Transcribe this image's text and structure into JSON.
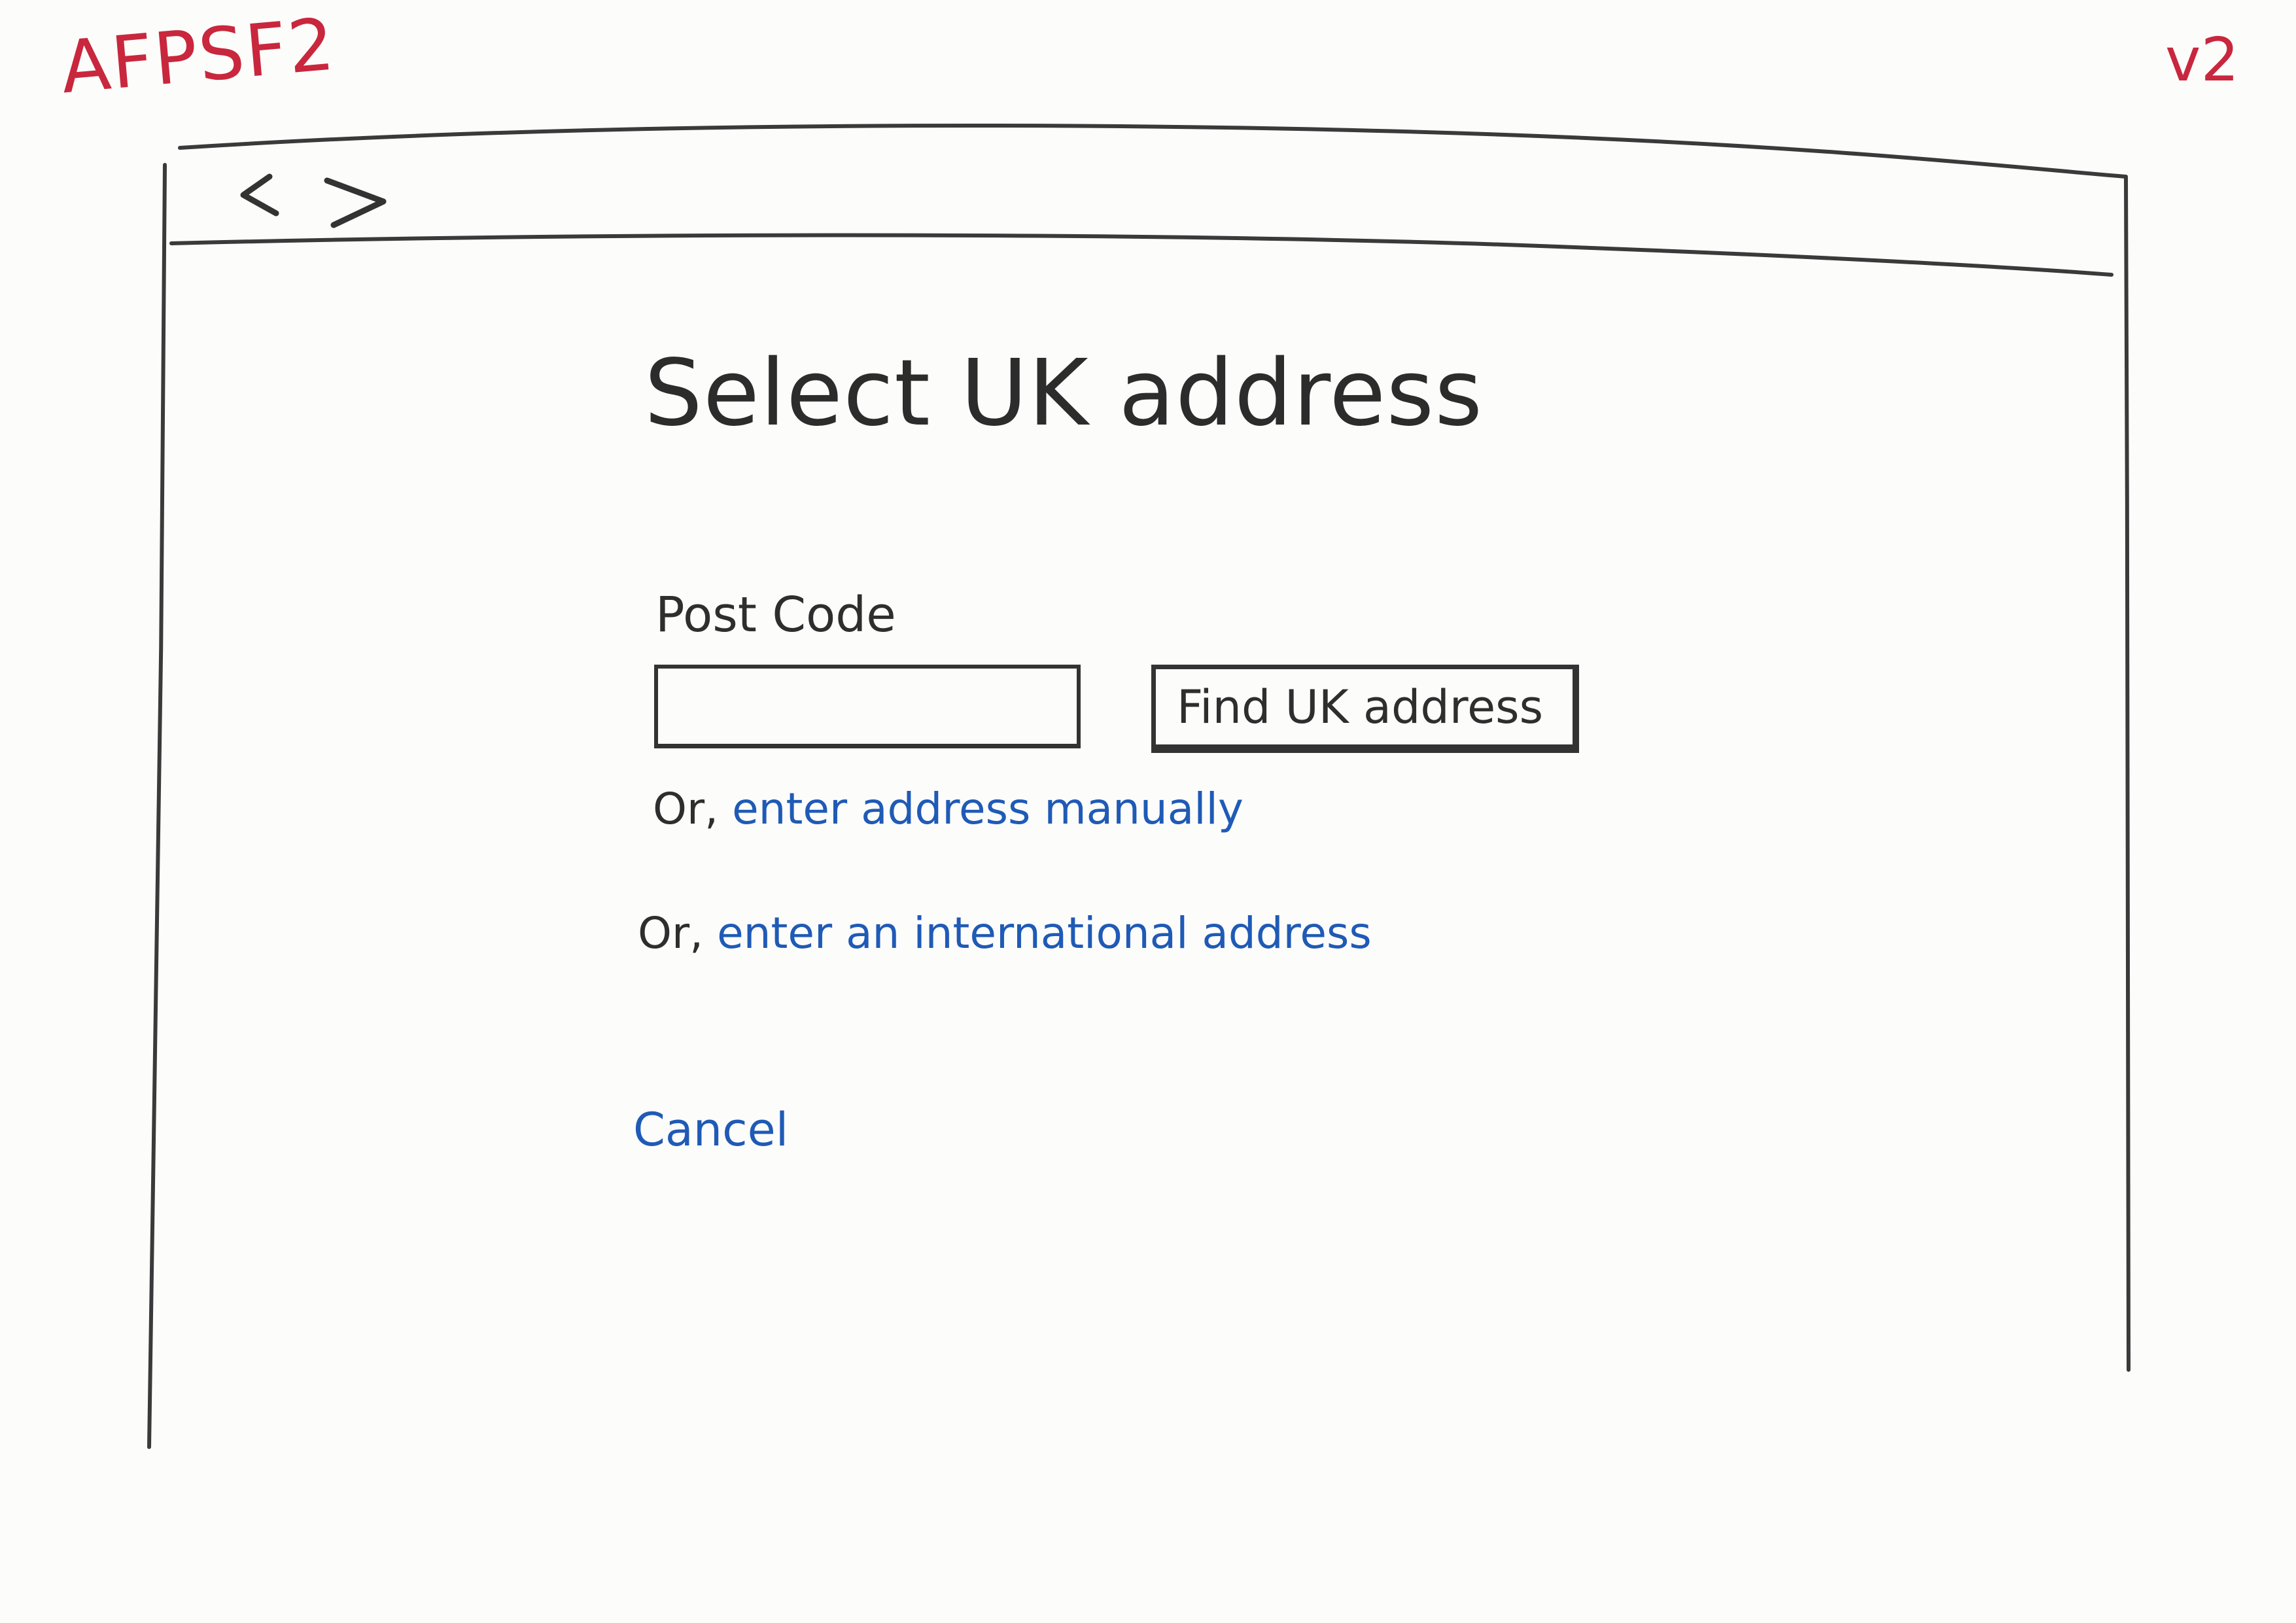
{
  "sheet": {
    "id": "AFPSF2",
    "version": "v2"
  },
  "browser": {
    "nav_icon": "back-forward-arrows-icon"
  },
  "page": {
    "title": "Select UK address",
    "postcode_label": "Post Code",
    "postcode_value": "",
    "find_button": "Find UK address",
    "manual_prefix": "Or,",
    "manual_link": "enter address manually",
    "international_prefix": "Or,",
    "international_link": "enter an international address",
    "cancel_link": "Cancel"
  },
  "colors": {
    "annotation": "#c8273d",
    "link": "#1f5ab6",
    "ink": "#333333"
  }
}
